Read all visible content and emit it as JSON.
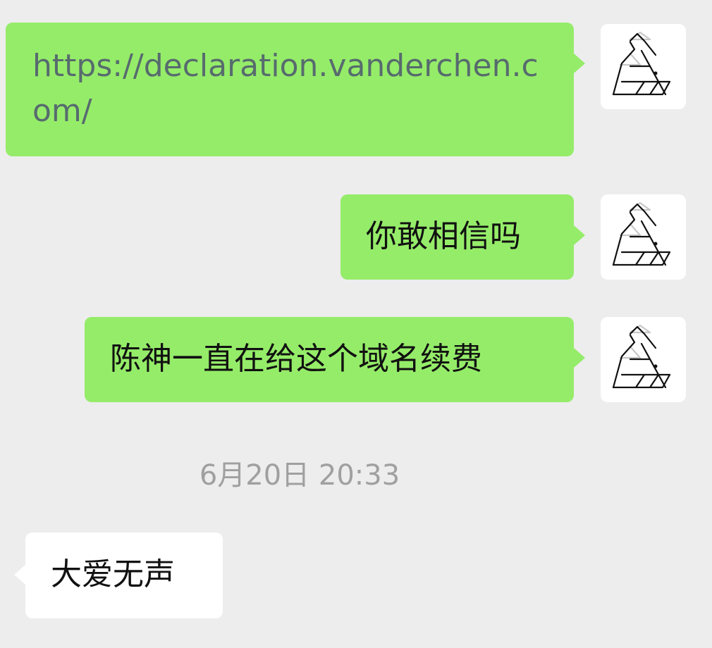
{
  "chat": {
    "messages": [
      {
        "id": "msg-1",
        "sender": "self",
        "type": "link",
        "text": "https://declaration.vanderchen.com/"
      },
      {
        "id": "msg-2",
        "sender": "self",
        "type": "text",
        "text": "你敢相信吗"
      },
      {
        "id": "msg-3",
        "sender": "self",
        "type": "text",
        "text": "陈神一直在给这个域名续费"
      },
      {
        "id": "msg-4",
        "sender": "other",
        "type": "text",
        "text": "大爱无声"
      }
    ],
    "timestamp": "6月20日 20:33"
  },
  "icons": {
    "avatar": "geometric-triangle-logo-avatar"
  },
  "colors": {
    "background": "#ededed",
    "sent_bubble": "#95ec69",
    "received_bubble": "#ffffff",
    "link_text": "#576b6e",
    "timestamp_text": "#a0a0a0"
  }
}
